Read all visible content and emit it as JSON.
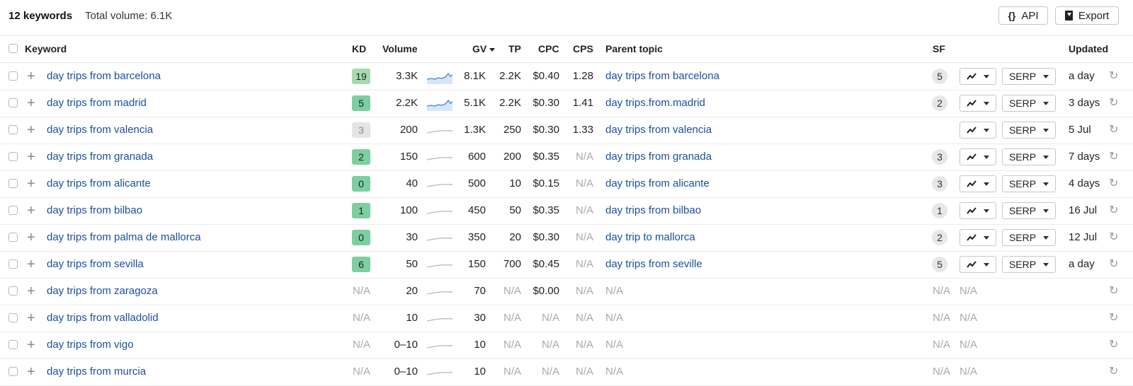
{
  "header": {
    "keyword_count": "12 keywords",
    "total_volume": "Total volume: 6.1K",
    "api_label": "API",
    "export_label": "Export"
  },
  "columns": {
    "keyword": "Keyword",
    "kd": "KD",
    "volume": "Volume",
    "gv": "GV",
    "tp": "TP",
    "cpc": "CPC",
    "cps": "CPS",
    "parent_topic": "Parent topic",
    "sf": "SF",
    "updated": "Updated"
  },
  "colors": {
    "link": "#1a4f9c",
    "kd_easy": "#7bcfa0",
    "kd_light": "#a6dab1",
    "kd_neutral": "#e4e4e4",
    "spark_blue": "#3d7fd6",
    "spark_grey": "#b8b8b8"
  },
  "rows": [
    {
      "keyword": "day trips from barcelona",
      "kd": "19",
      "kd_level": "light",
      "volume": "3.3K",
      "spark": "blue",
      "gv": "8.1K",
      "tp": "2.2K",
      "cpc": "$0.40",
      "cps": "1.28",
      "parent": "day trips from barcelona",
      "sf": "5",
      "trend_icon": "trend-line-icon",
      "serp": "SERP",
      "updated": "a day"
    },
    {
      "keyword": "day trips from madrid",
      "kd": "5",
      "kd_level": "easy",
      "volume": "2.2K",
      "spark": "blue",
      "gv": "5.1K",
      "tp": "2.2K",
      "cpc": "$0.30",
      "cps": "1.41",
      "parent": "day trips.from.madrid",
      "sf": "2",
      "trend_icon": "trend-line-icon",
      "serp": "SERP",
      "updated": "3 days"
    },
    {
      "keyword": "day trips from valencia",
      "kd": "3",
      "kd_level": "neutral",
      "volume": "200",
      "spark": "grey",
      "gv": "1.3K",
      "tp": "250",
      "cpc": "$0.30",
      "cps": "1.33",
      "parent": "day trips from valencia",
      "sf": "",
      "trend_icon": "trend-line-icon",
      "serp": "SERP",
      "updated": "5 Jul"
    },
    {
      "keyword": "day trips from granada",
      "kd": "2",
      "kd_level": "easy",
      "volume": "150",
      "spark": "grey",
      "gv": "600",
      "tp": "200",
      "cpc": "$0.35",
      "cps": "N/A",
      "parent": "day trips from granada",
      "sf": "3",
      "trend_icon": "trend-line-icon",
      "serp": "SERP",
      "updated": "7 days"
    },
    {
      "keyword": "day trips from alicante",
      "kd": "0",
      "kd_level": "easy",
      "volume": "40",
      "spark": "grey",
      "gv": "500",
      "tp": "10",
      "cpc": "$0.15",
      "cps": "N/A",
      "parent": "day trips from alicante",
      "sf": "3",
      "trend_icon": "trend-line-icon",
      "serp": "SERP",
      "updated": "4 days"
    },
    {
      "keyword": "day trips from bilbao",
      "kd": "1",
      "kd_level": "easy",
      "volume": "100",
      "spark": "grey",
      "gv": "450",
      "tp": "50",
      "cpc": "$0.35",
      "cps": "N/A",
      "parent": "day trips from bilbao",
      "sf": "1",
      "trend_icon": "trend-line-icon",
      "serp": "SERP",
      "updated": "16 Jul"
    },
    {
      "keyword": "day trips from palma de mallorca",
      "kd": "0",
      "kd_level": "easy",
      "volume": "30",
      "spark": "grey",
      "gv": "350",
      "tp": "20",
      "cpc": "$0.30",
      "cps": "N/A",
      "parent": "day trip to mallorca",
      "sf": "2",
      "trend_icon": "trend-line-icon",
      "serp": "SERP",
      "updated": "12 Jul"
    },
    {
      "keyword": "day trips from sevilla",
      "kd": "6",
      "kd_level": "easy",
      "volume": "50",
      "spark": "grey",
      "gv": "150",
      "tp": "700",
      "cpc": "$0.45",
      "cps": "N/A",
      "parent": "day trips from seville",
      "sf": "5",
      "trend_icon": "trend-line-icon",
      "serp": "SERP",
      "updated": "a day"
    },
    {
      "keyword": "day trips from zaragoza",
      "kd": "N/A",
      "kd_level": "na",
      "volume": "20",
      "spark": "grey",
      "gv": "70",
      "tp": "N/A",
      "cpc": "$0.00",
      "cps": "N/A",
      "parent": "N/A",
      "sf": "N/A",
      "sf_col2": "N/A",
      "updated": ""
    },
    {
      "keyword": "day trips from valladolid",
      "kd": "N/A",
      "kd_level": "na",
      "volume": "10",
      "spark": "grey",
      "gv": "30",
      "tp": "N/A",
      "cpc": "N/A",
      "cps": "N/A",
      "parent": "N/A",
      "sf": "N/A",
      "sf_col2": "N/A",
      "updated": ""
    },
    {
      "keyword": "day trips from vigo",
      "kd": "N/A",
      "kd_level": "na",
      "volume": "0–10",
      "spark": "grey",
      "gv": "10",
      "tp": "N/A",
      "cpc": "N/A",
      "cps": "N/A",
      "parent": "N/A",
      "sf": "N/A",
      "sf_col2": "N/A",
      "updated": ""
    },
    {
      "keyword": "day trips from murcia",
      "kd": "N/A",
      "kd_level": "na",
      "volume": "0–10",
      "spark": "grey",
      "gv": "10",
      "tp": "N/A",
      "cpc": "N/A",
      "cps": "N/A",
      "parent": "N/A",
      "sf": "N/A",
      "sf_col2": "N/A",
      "updated": ""
    }
  ]
}
